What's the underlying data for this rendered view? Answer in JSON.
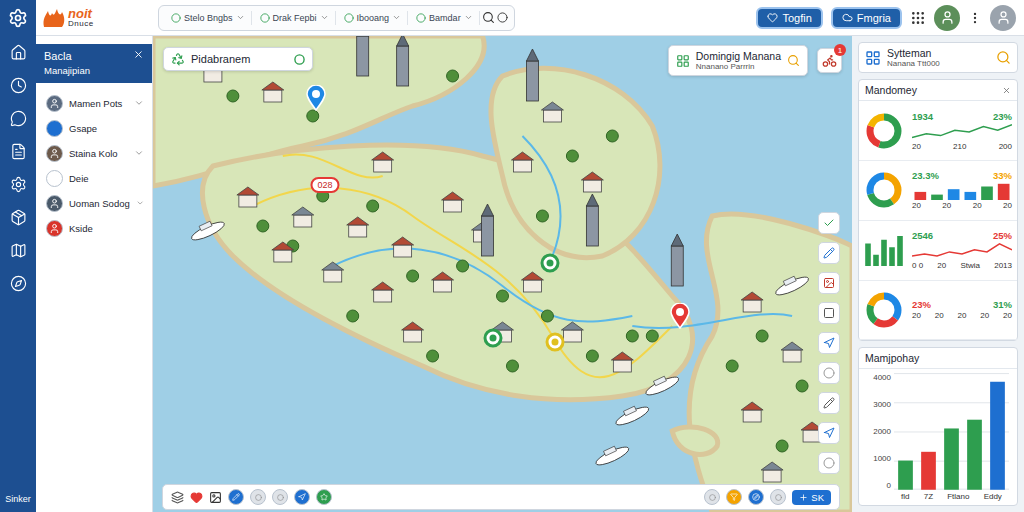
{
  "logo": {
    "top": "noit",
    "bottom": "Dnuce"
  },
  "toolbar": {
    "tabs": [
      {
        "label": "Stelo Bngbs",
        "selected": false
      },
      {
        "label": "Drak Fepbi",
        "selected": false
      },
      {
        "label": "Ibooang",
        "selected": false
      },
      {
        "label": "Bamdar",
        "selected": false
      }
    ]
  },
  "header_buttons": [
    {
      "label": "Togfin"
    },
    {
      "label": "Fmgria"
    }
  ],
  "rail": {
    "footer": "Sinker"
  },
  "side_panel": {
    "title": "Bacla",
    "subtitle": "Manajipian",
    "items": [
      {
        "label": "Mamen Pots",
        "kind": "avatar",
        "color": "#5b6b80",
        "expandable": true,
        "expanded": false
      },
      {
        "label": "Gsape",
        "kind": "icon",
        "color": "#1e6fd0",
        "expandable": false,
        "expanded": false
      },
      {
        "label": "Staina Kolo",
        "kind": "avatar",
        "color": "#6d5a4b",
        "expandable": true,
        "expanded": false
      },
      {
        "label": "Deie",
        "kind": "icon",
        "color": "#ffffff",
        "expandable": false,
        "expanded": false
      },
      {
        "label": "Uoman Sodog",
        "kind": "avatar",
        "color": "#4a5a6a",
        "expandable": true,
        "expanded": false
      },
      {
        "label": "Kside",
        "kind": "avatar",
        "color": "#d9342b",
        "expandable": false,
        "expanded": false
      }
    ]
  },
  "map": {
    "search": {
      "label": "Pidabranem"
    },
    "info": {
      "title": "Domingig Manana",
      "subtitle": "Nnanano Parrrin",
      "badge": "1"
    },
    "badge_label": "028",
    "pins": [
      {
        "color": "#1e88e5"
      },
      {
        "color": "#2e9e4f"
      },
      {
        "color": "#2e9e4f"
      },
      {
        "color": "#e53935"
      },
      {
        "color": "#e0c020"
      }
    ],
    "bottom_button": "SK"
  },
  "right_search": {
    "title": "Sytteman",
    "subtitle": "Nanana Ttt000"
  },
  "overview": {
    "title": "Mandomey",
    "rows": [
      {
        "left": {
          "kind": "donut",
          "values": [
            55,
            25,
            20
          ],
          "colors": [
            "#2e9e4f",
            "#e53935",
            "#f4b400"
          ]
        },
        "figures": [
          {
            "text": "1934",
            "color": "#2e9e4f"
          },
          {
            "text": "23%",
            "color": "#2e9e4f"
          }
        ],
        "right": {
          "kind": "line",
          "values": [
            2,
            4,
            3,
            6,
            5,
            8,
            6,
            9
          ],
          "colors": [
            "#2e9e4f"
          ]
        },
        "labels": [
          "20",
          "210",
          "200"
        ]
      },
      {
        "left": {
          "kind": "donut",
          "values": [
            40,
            30,
            30
          ],
          "colors": [
            "#f4a300",
            "#2e9e4f",
            "#1e88e5"
          ]
        },
        "figures": [
          {
            "text": "23.3%",
            "color": "#2e9e4f"
          },
          {
            "text": "33%",
            "color": "#f4a300"
          }
        ],
        "right": {
          "kind": "bars",
          "values": [
            3,
            2,
            4,
            3,
            5,
            6
          ],
          "colors": [
            "#e53935",
            "#2e9e4f",
            "#1e88e5",
            "#1e88e5",
            "#2e9e4f",
            "#e53935"
          ]
        },
        "labels": [
          "20",
          "20",
          "20",
          "20"
        ]
      },
      {
        "left": {
          "kind": "bars",
          "values": [
            6,
            3,
            7,
            5,
            8
          ],
          "colors": [
            "#2e9e4f",
            "#2e9e4f",
            "#2e9e4f",
            "#2e9e4f",
            "#2e9e4f"
          ]
        },
        "figures": [
          {
            "text": "2546",
            "color": "#2e9e4f"
          },
          {
            "text": "25%",
            "color": "#e53935"
          }
        ],
        "right": {
          "kind": "line",
          "values": [
            2,
            3,
            2,
            4,
            3,
            5,
            4,
            8,
            5
          ],
          "colors": [
            "#e53935"
          ]
        },
        "labels": [
          "0 0",
          "20",
          "Stwia",
          "2013"
        ]
      },
      {
        "left": {
          "kind": "donut",
          "values": [
            35,
            25,
            20,
            20
          ],
          "colors": [
            "#1e88e5",
            "#e53935",
            "#2e9e4f",
            "#f4a300"
          ]
        },
        "figures": [
          {
            "text": "23%",
            "color": "#e53935"
          },
          {
            "text": "31%",
            "color": "#2e9e4f"
          }
        ],
        "labels": [
          "20",
          "20",
          "20",
          "20",
          "20"
        ]
      }
    ]
  },
  "bar_chart": {
    "title": "Mamjpohay",
    "ticks": [
      "4000",
      "3000",
      "2000",
      "1000",
      "0"
    ],
    "max": 4000,
    "values": [
      1000,
      1300,
      2100,
      2400,
      3700
    ],
    "colors": [
      "#2e9e4f",
      "#e53935",
      "#2e9e4f",
      "#2e9e4f",
      "#1e6fd0"
    ],
    "labels": [
      "fld",
      "7Z",
      "Ftlano",
      "Eddy"
    ]
  }
}
